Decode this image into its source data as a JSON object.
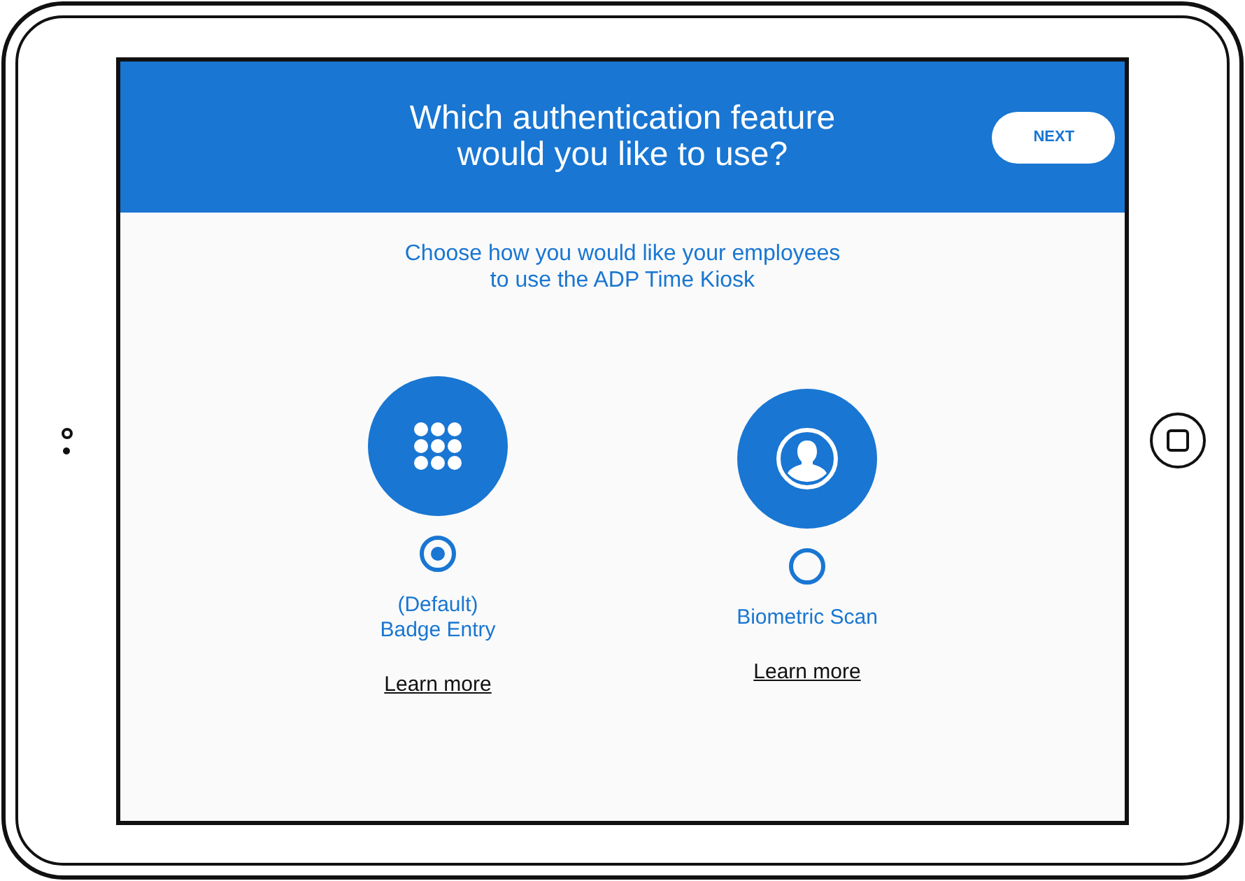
{
  "header": {
    "title_lines": [
      "Which authentication feature",
      "would you like to use?"
    ],
    "next_button": "NEXT"
  },
  "subtitle_lines": [
    "Choose how you would like your employees",
    "to use the ADP Time Kiosk"
  ],
  "options": [
    {
      "kind": "keypad",
      "label_lines": [
        "(Default)",
        "Badge Entry"
      ],
      "selected": true,
      "link": "Learn more"
    },
    {
      "kind": "person",
      "label_lines": [
        "Biometric Scan"
      ],
      "selected": false,
      "link": "Learn more"
    }
  ]
}
